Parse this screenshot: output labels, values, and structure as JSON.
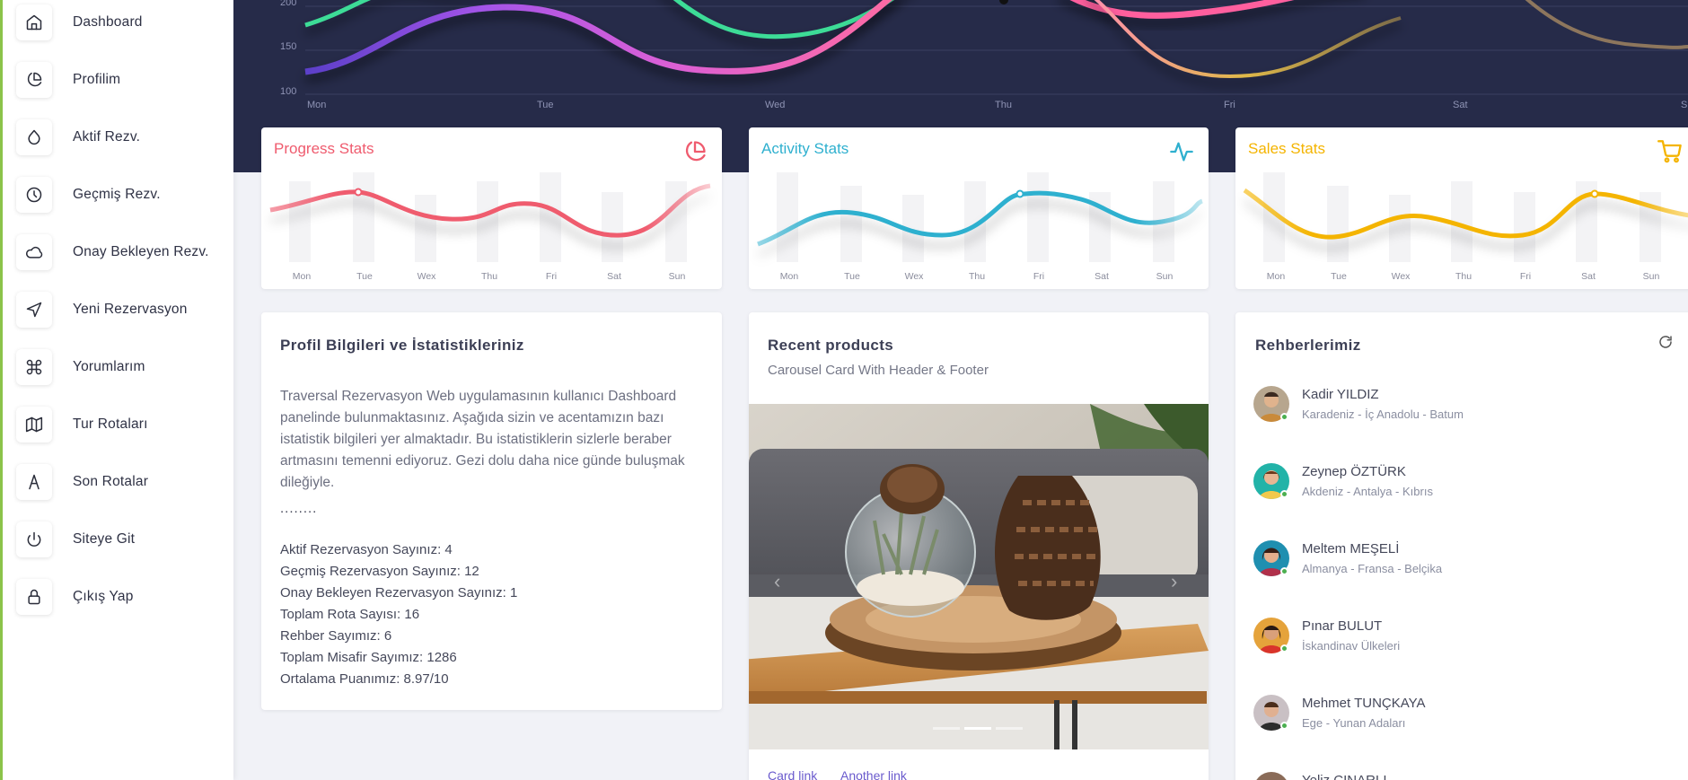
{
  "sidebar": {
    "items": [
      {
        "label": "Dashboard"
      },
      {
        "label": "Profilim"
      },
      {
        "label": "Aktif Rezv."
      },
      {
        "label": "Geçmiş Rezv."
      },
      {
        "label": "Onay Bekleyen Rezv."
      },
      {
        "label": "Yeni Rezervasyon"
      },
      {
        "label": "Yorumlarım"
      },
      {
        "label": "Tur Rotaları"
      },
      {
        "label": "Son Rotalar"
      },
      {
        "label": "Siteye Git"
      },
      {
        "label": "Çıkış Yap"
      }
    ]
  },
  "hero_chart": {
    "y_ticks": [
      "200",
      "150",
      "100"
    ],
    "x_ticks": [
      "Mon",
      "Tue",
      "Wed",
      "Thu",
      "Fri",
      "Sat",
      "S"
    ],
    "series_colors": [
      "#3ddc97",
      "#b056f0",
      "#ff5f9e",
      "#e0b94a"
    ]
  },
  "stats": {
    "progress": {
      "title": "Progress Stats",
      "color": "#ef5b6e",
      "icon": "pie-chart-icon"
    },
    "activity": {
      "title": "Activity Stats",
      "color": "#2fb0cf",
      "icon": "activity-icon"
    },
    "sales": {
      "title": "Sales Stats",
      "color": "#f4b400",
      "icon": "cart-icon"
    },
    "days": [
      "Mon",
      "Tue",
      "Wex",
      "Thu",
      "Fri",
      "Sat",
      "Sun"
    ]
  },
  "profile": {
    "title": "Profil Bilgileri ve İstatistikleriniz",
    "intro": "Traversal Rezervasyon Web uygulamasının kullanıcı Dashboard panelinde bulunmaktasınız. Aşağıda sizin ve acentamızın bazı istatistik bilgileri yer almaktadır. Bu istatistiklerin sizlerle beraber artmasını temenni ediyoruz. Gezi dolu daha nice günde buluşmak dileğiyle.",
    "dots": "........",
    "stats": [
      "Aktif Rezervasyon Sayınız: 4",
      "Geçmiş Rezervasyon Sayınız: 12",
      "Onay Bekleyen Rezervasyon Sayınız: 1",
      "Toplam Rota Sayısı: 16",
      "Rehber Sayımız: 6",
      "Toplam Misafir Sayımız: 1286",
      "Ortalama Puanımız: 8.97/10"
    ]
  },
  "products": {
    "title": "Recent products",
    "subtitle": "Carousel Card With Header & Footer",
    "links": [
      "Card link",
      "Another link"
    ]
  },
  "guides": {
    "title": "Rehberlerimiz",
    "items": [
      {
        "name": "Kadir YILDIZ",
        "route": "Karadeniz - İç Anadolu - Batum"
      },
      {
        "name": "Zeynep ÖZTÜRK",
        "route": "Akdeniz - Antalya - Kıbrıs"
      },
      {
        "name": "Meltem MEŞELİ",
        "route": "Almanya - Fransa - Belçika"
      },
      {
        "name": "Pınar BULUT",
        "route": "İskandinav Ülkeleri"
      },
      {
        "name": "Mehmet TUNÇKAYA",
        "route": "Ege - Yunan Adaları"
      },
      {
        "name": "Yeliz ÇINARLI",
        "route": ""
      }
    ]
  }
}
